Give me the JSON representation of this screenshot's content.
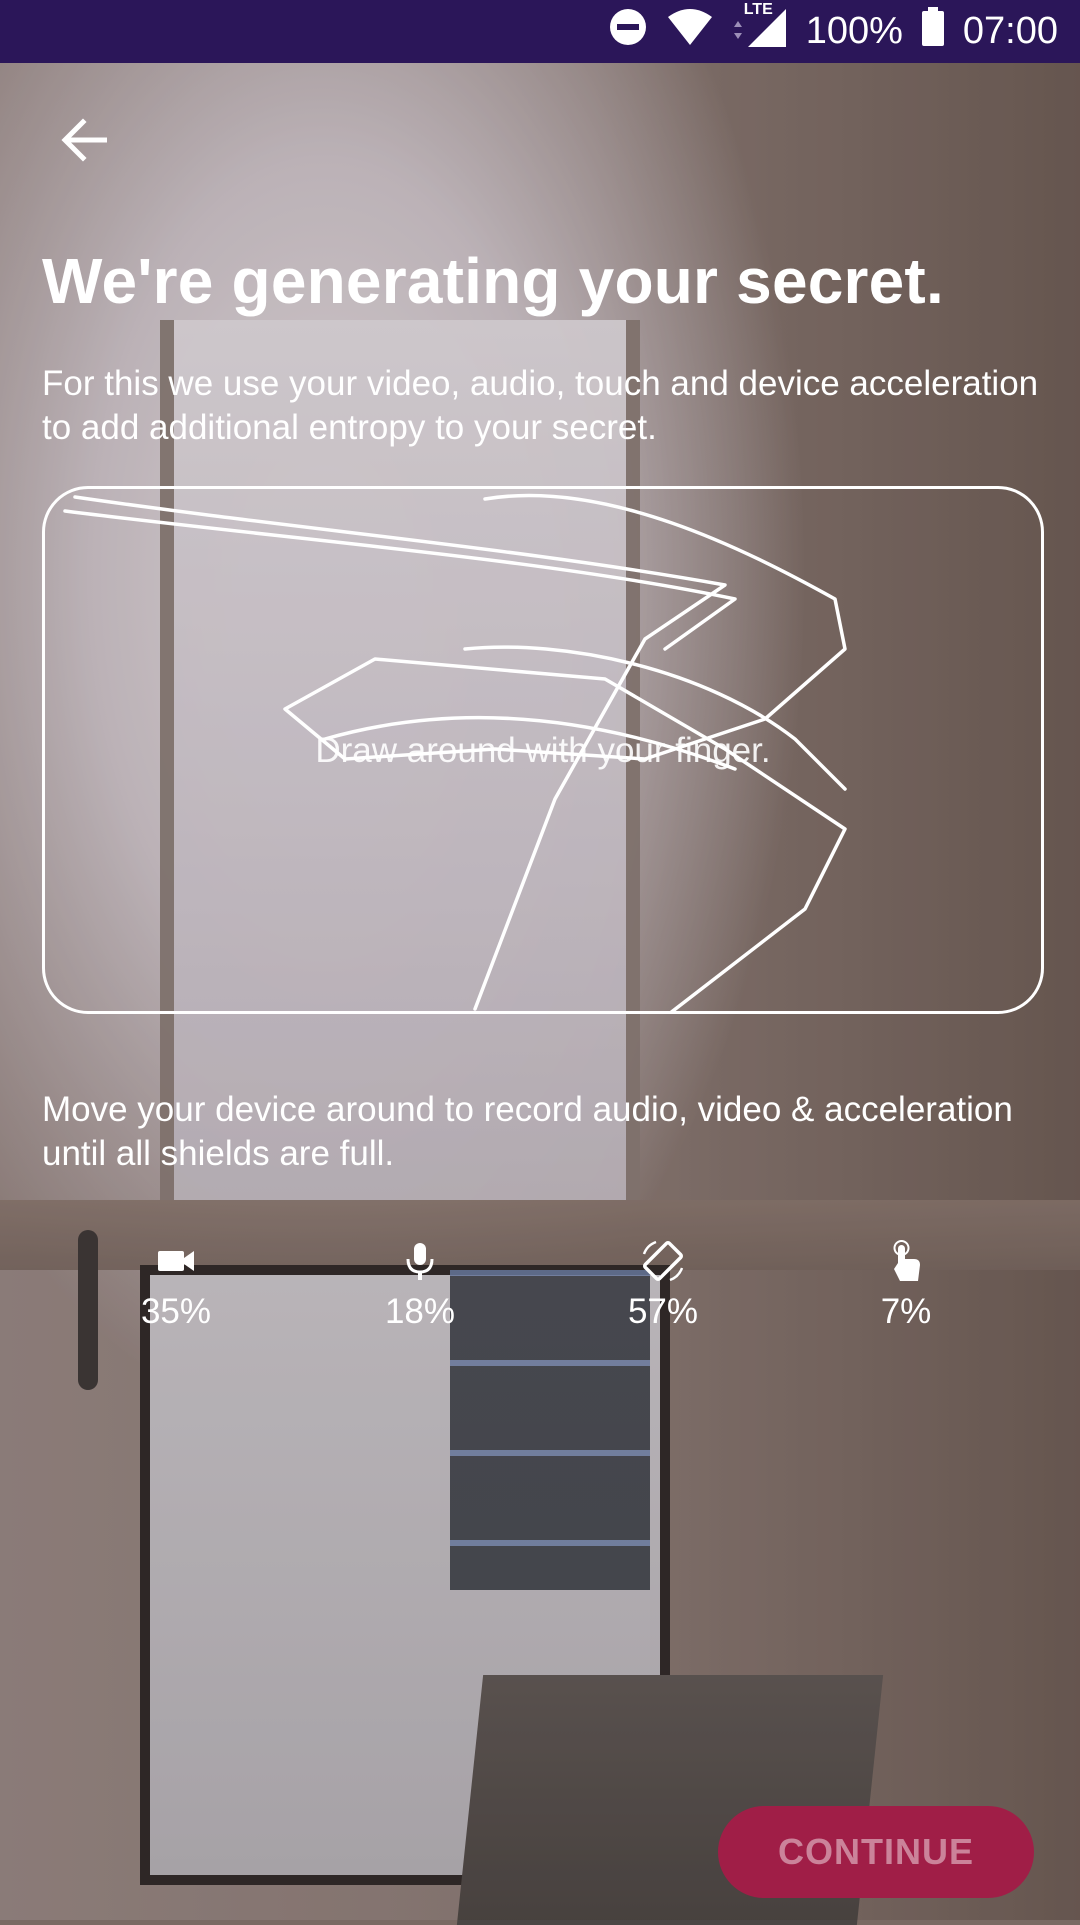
{
  "status_bar": {
    "icons": [
      "do-not-disturb-icon",
      "wifi-icon",
      "lte-signal-icon",
      "battery-icon"
    ],
    "network_label": "LTE",
    "battery": "100%",
    "time": "07:00"
  },
  "header": {
    "back_icon": "arrow-back-icon",
    "title": "We're generating your secret."
  },
  "intro": "For this we use your video, audio, touch and device acceleration to add additional entropy to your secret.",
  "draw_area": {
    "hint": "Draw around with your finger."
  },
  "instruction": "Move your device around to record audio, video & acceleration until all shields are full.",
  "indicators": [
    {
      "icon": "video-camera-icon",
      "value": "35%",
      "fraction": 0.35
    },
    {
      "icon": "microphone-icon",
      "value": "18%",
      "fraction": 0.18
    },
    {
      "icon": "screen-rotation-icon",
      "value": "57%",
      "fraction": 0.57
    },
    {
      "icon": "touch-icon",
      "value": "7%",
      "fraction": 0.07
    }
  ],
  "footer": {
    "continue_label": "CONTINUE"
  },
  "colors": {
    "status_bar": "#2b1659",
    "continue_button": "#a01e47",
    "text": "#ffffff"
  }
}
